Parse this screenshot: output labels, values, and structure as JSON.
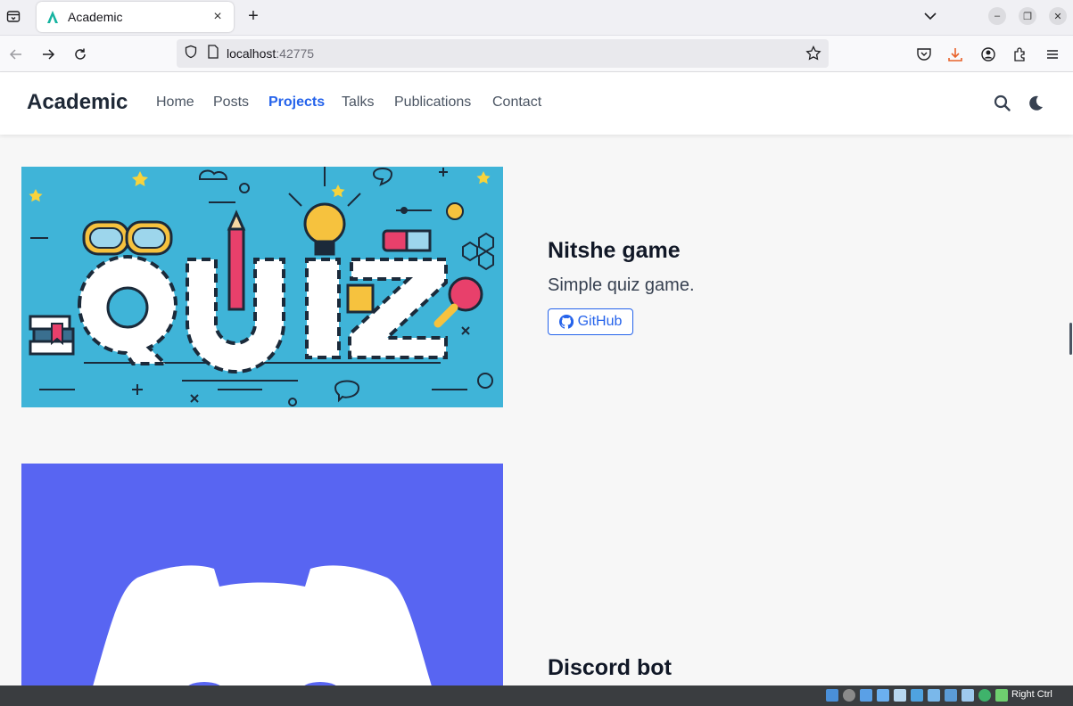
{
  "browser": {
    "tab_title": "Academic",
    "url_host": "localhost",
    "url_port": ":42775"
  },
  "site": {
    "brand": "Academic",
    "nav": [
      "Home",
      "Posts",
      "Projects",
      "Talks",
      "Publications",
      "Contact"
    ],
    "active_nav": "Projects"
  },
  "projects": [
    {
      "title": "Nitshe game",
      "summary": "Simple quiz game.",
      "link_label": "GitHub"
    },
    {
      "title": "Discord bot"
    }
  ],
  "taskbar": {
    "host_key_label": "Right Ctrl"
  },
  "colors": {
    "accent": "#2563eb",
    "quiz_bg": "#3fb4d8",
    "discord_bg": "#5865f2"
  }
}
